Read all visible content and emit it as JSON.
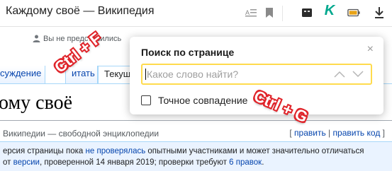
{
  "browser": {
    "window_title": "Каждому своё — Википедия",
    "icons": {
      "reader": "reader-mode-icon",
      "bookmark": "bookmark-icon",
      "extension": "extension-icon",
      "kaspersky": "kaspersky-icon",
      "kaspersky_letter": "K",
      "battery": "battery-icon",
      "download": "download-icon"
    },
    "colors": {
      "kaspersky": "#00a88e",
      "battery": "#e8a317"
    }
  },
  "wiki": {
    "user_status": "Вы не представились",
    "tabs": {
      "discussion": "суждение",
      "read": "итать",
      "current": "Текущ"
    },
    "heading": "ому своё",
    "from_wiki": "Википедии — свободной энциклопедии",
    "edit_links": {
      "open": "[ ",
      "edit": "править",
      "sep": " | ",
      "edit_code": "править код",
      "close": " ]"
    },
    "notice": {
      "line1_a": "ерсия страницы пока ",
      "line1_link": "не проверялась",
      "line1_b": " опытными участниками и может значительно отличаться",
      "line2_a": "от ",
      "line2_link1": "версии",
      "line2_b": ", проверенной 14 января 2019; проверки требуют ",
      "line2_link2": "6 правок",
      "line2_c": "."
    },
    "colors": {
      "link": "#0645ad",
      "notice_bg": "#eaf3ff"
    }
  },
  "find_popup": {
    "title": "Поиск по странице",
    "close_symbol": "×",
    "input_value": "",
    "input_placeholder": "Какое слово найти?",
    "exact_match_label": "Точное совпадение",
    "exact_match_checked": false,
    "accent_color": "#ffdb4d"
  },
  "annotations": {
    "shortcut_open": "Ctrl + F",
    "shortcut_next": "Ctrl + G",
    "color": "#e0242a"
  }
}
